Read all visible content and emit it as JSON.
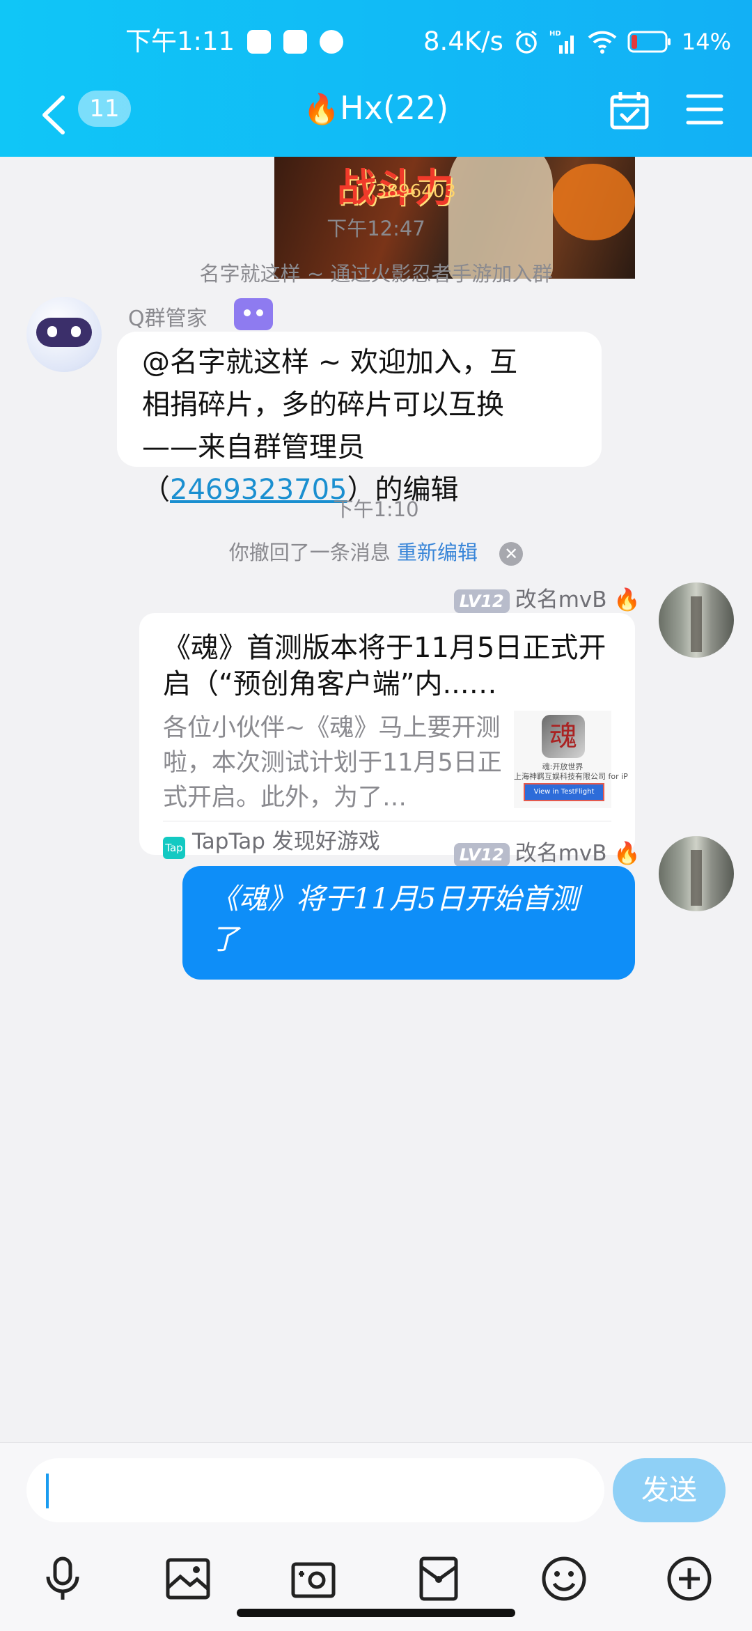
{
  "status_bar": {
    "time": "下午1:11",
    "net_speed": "8.4K/s",
    "hd": "HD",
    "battery": "14%"
  },
  "header": {
    "unread_count": "11",
    "title_icon": "🔥",
    "title": "Hx(22)"
  },
  "image_message": {
    "overlay_text": "战斗力",
    "overlay_number": "3896403"
  },
  "messages": {
    "time1": "下午12:47",
    "join_notice": "名字就这样 ~ 通过火影忍者手游加入群",
    "bot_sender": "Q群管家",
    "bot_text_line1": "@名字就这样 ~ 欢迎加入，互",
    "bot_text_line2": "相捐碎片，多的碎片可以互换",
    "bot_text_line3": "——来自群管理员",
    "bot_text_line4_prefix": "（",
    "bot_text_qq": "2469323705",
    "bot_text_line4_suffix": "）的编辑",
    "time2": "下午1:10",
    "recall_text": "你撤回了一条消息",
    "recall_edit": "重新编辑",
    "user_level": "LV12",
    "user_name": "改名mvB",
    "user_flame": "🔥",
    "card_title": "《魂》首测版本将于11月5日正式开启（“预创角客户端”内...…",
    "card_desc": "各位小伙伴~《魂》马上要开测啦，本次测试计划于11月5日正式开启。此外，为了…",
    "card_thumb_logo": "魂",
    "card_thumb_line1": "魂:开放世界",
    "card_thumb_line2": "上海神羁互娱科技有限公司 for iP",
    "card_thumb_button": "View in TestFlight",
    "card_source_logo": "Tap",
    "card_source": "TapTap 发现好游戏",
    "user_text": "《魂》将于11月5日开始首测了"
  },
  "input": {
    "value": "",
    "send_label": "发送"
  },
  "toolbar_icons": [
    "microphone-icon",
    "image-icon",
    "camera-icon",
    "red-packet-icon",
    "emoji-icon",
    "plus-icon"
  ]
}
